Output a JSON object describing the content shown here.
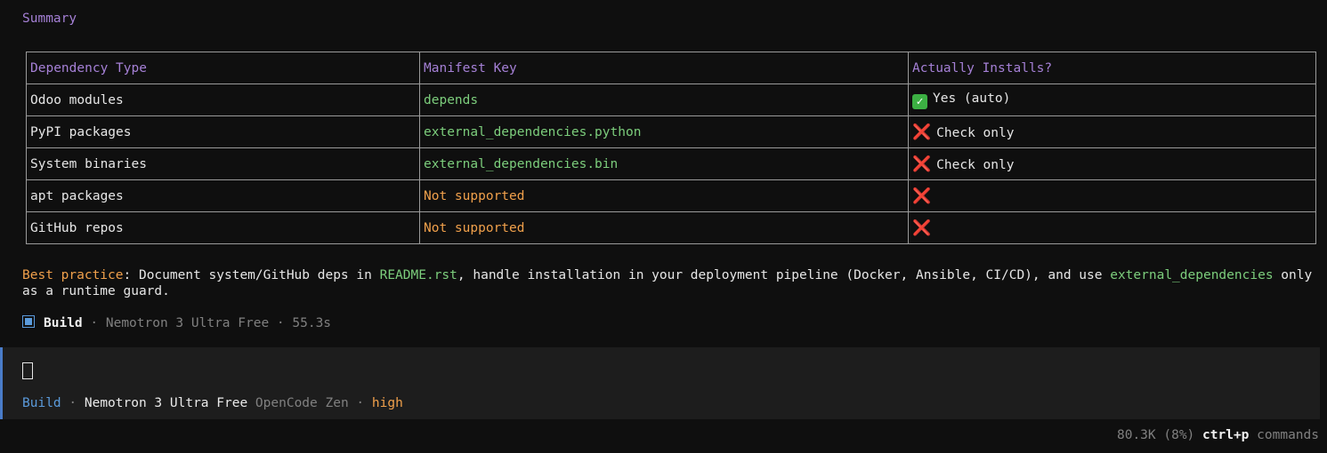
{
  "summary_title": "Summary",
  "table": {
    "headers": [
      "Dependency Type",
      "Manifest Key",
      "Actually Installs?"
    ],
    "rows": [
      {
        "type": "Odoo modules",
        "key": "depends",
        "key_style": "green",
        "installs": "Yes (auto)",
        "status": "check"
      },
      {
        "type": "PyPI packages",
        "key": "external_dependencies.python",
        "key_style": "green",
        "installs": "Check only",
        "status": "cross"
      },
      {
        "type": "System binaries",
        "key": "external_dependencies.bin",
        "key_style": "green",
        "installs": "Check only",
        "status": "cross"
      },
      {
        "type": "apt packages",
        "key": "Not supported",
        "key_style": "orange",
        "installs": "",
        "status": "cross"
      },
      {
        "type": "GitHub repos",
        "key": "Not supported",
        "key_style": "orange",
        "installs": "",
        "status": "cross"
      }
    ]
  },
  "practice": {
    "label": "Best practice",
    "text1": ": Document system/GitHub deps in ",
    "file": "README.rst",
    "text2": ", handle installation in your deployment pipeline (Docker, Ansible, CI/CD), and use ",
    "code": "external_dependencies",
    "text3": " only as a runtime guard."
  },
  "build_status": {
    "agent": "Build",
    "sep1": " · ",
    "model": "Nemotron 3 Ultra Free",
    "sep2": " · ",
    "duration": "55.3s"
  },
  "prompt": {
    "mode": "Build",
    "sep1": " · ",
    "model": "Nemotron 3 Ultra Free",
    "provider": "OpenCode Zen",
    "sep2": " · ",
    "effort": "high"
  },
  "footer": {
    "tokens": "80.3K (8%)",
    "shortcut": "ctrl+p",
    "shortcut_label": "commands"
  },
  "colors": {
    "heading": "#a580d6",
    "green": "#7ccd7c",
    "orange": "#f0a04b",
    "blue": "#5b9bdc",
    "cross": "#e0302a",
    "check": "#3cb043"
  }
}
